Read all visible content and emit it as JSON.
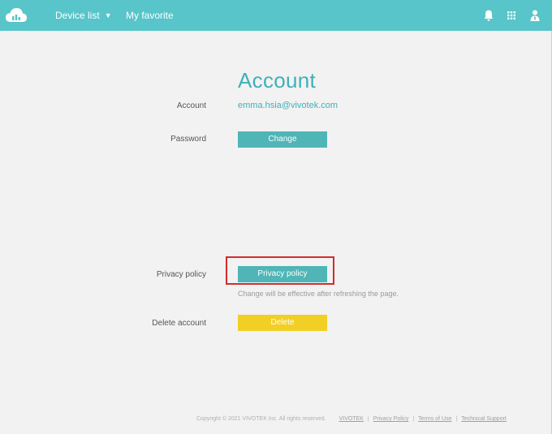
{
  "header": {
    "nav": [
      {
        "label": "Device list",
        "has_dropdown": true
      },
      {
        "label": "My favorite",
        "has_dropdown": false
      }
    ],
    "icons": [
      "cloud-logo-icon",
      "bell-icon",
      "apps-grid-icon",
      "user-icon"
    ],
    "bar_color": "#57c5c9"
  },
  "account": {
    "title": "Account",
    "account_label": "Account",
    "email": "emma.hsia@vivotek.com",
    "password_label": "Password",
    "change_button": "Change",
    "privacy_label": "Privacy policy",
    "privacy_button": "Privacy policy",
    "privacy_note": "Change will be effective after refreshing the page.",
    "delete_label": "Delete account",
    "delete_button": "Delete"
  },
  "colors": {
    "accent": "#4fb5b7",
    "delete": "#f2cf25",
    "highlight": "#d52b2b"
  },
  "footer": {
    "copyright": "Copyright © 2021 VIVOTEK Inc. All rights reserved.",
    "links": [
      "VIVOTEK",
      "Privacy Policy",
      "Terms of Use",
      "Technical Support"
    ]
  }
}
